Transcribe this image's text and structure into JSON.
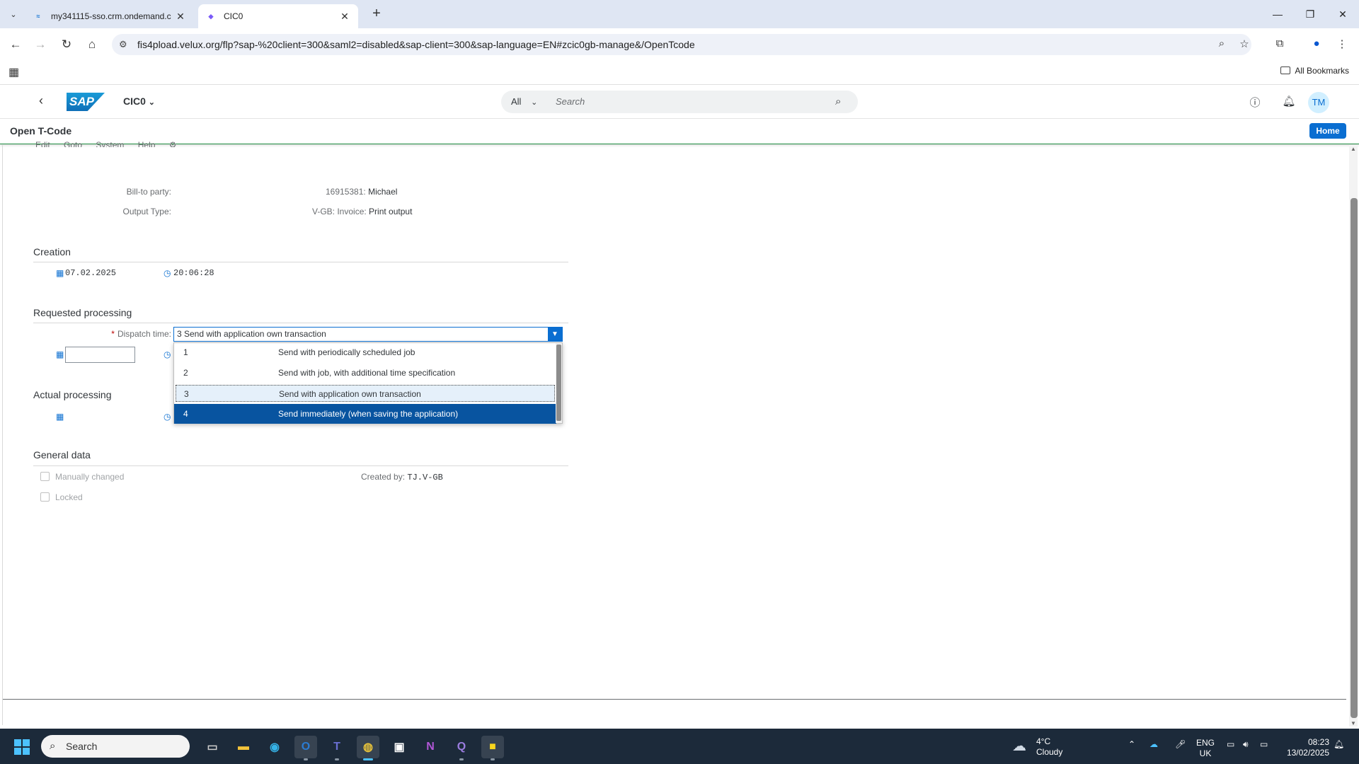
{
  "browser": {
    "tabs": [
      {
        "title": "my341115-sso.crm.ondemand.c",
        "favicon": "sap-icon"
      },
      {
        "title": "CIC0",
        "favicon": "cube-icon"
      }
    ],
    "url": "fis4pload.velux.org/flp?sap-%20client=300&saml2=disabled&sap-client=300&sap-language=EN#zcic0gb-manage&/OpenTcode",
    "bookmarks_label": "All Bookmarks"
  },
  "shell": {
    "logo_text": "SAP",
    "app_title": "CIC0",
    "search_scope": "All",
    "search_placeholder": "Search",
    "avatar_initials": "TM"
  },
  "subheader": {
    "title": "Open T-Code",
    "home_label": "Home",
    "menu": [
      "Edit",
      "Goto",
      "System",
      "Help"
    ]
  },
  "header_fields": {
    "bill_to_label": "Bill-to party:",
    "bill_to_id": "16915381:",
    "bill_to_name": "Michael",
    "output_type_label": "Output Type:",
    "output_type_code": "V-GB: Invoice:",
    "output_type_value": "Print output"
  },
  "creation": {
    "section_title": "Creation",
    "date": "07.02.2025",
    "time": "20:06:28"
  },
  "requested": {
    "section_title": "Requested processing",
    "dispatch_label": "Dispatch time:",
    "dispatch_value": "3 Send with application own transaction",
    "options": [
      {
        "key": "1",
        "text": "Send with periodically scheduled job"
      },
      {
        "key": "2",
        "text": "Send with job, with additional time specification"
      },
      {
        "key": "3",
        "text": "Send with application own transaction"
      },
      {
        "key": "4",
        "text": "Send immediately (when saving the application)"
      }
    ]
  },
  "actual": {
    "section_title": "Actual processing"
  },
  "general": {
    "section_title": "General data",
    "manually_changed": "Manually changed",
    "locked": "Locked",
    "created_by_label": "Created by:",
    "created_by_value": "TJ.V-GB"
  },
  "taskbar": {
    "search_label": "Search",
    "weather_temp": "4°C",
    "weather_text": "Cloudy",
    "lang_line1": "ENG",
    "lang_line2": "UK",
    "time": "08:23",
    "date": "13/02/2025"
  },
  "colors": {
    "sap_blue": "#0a6ed1",
    "selected_row": "#0854a0",
    "required": "#bb0000"
  }
}
